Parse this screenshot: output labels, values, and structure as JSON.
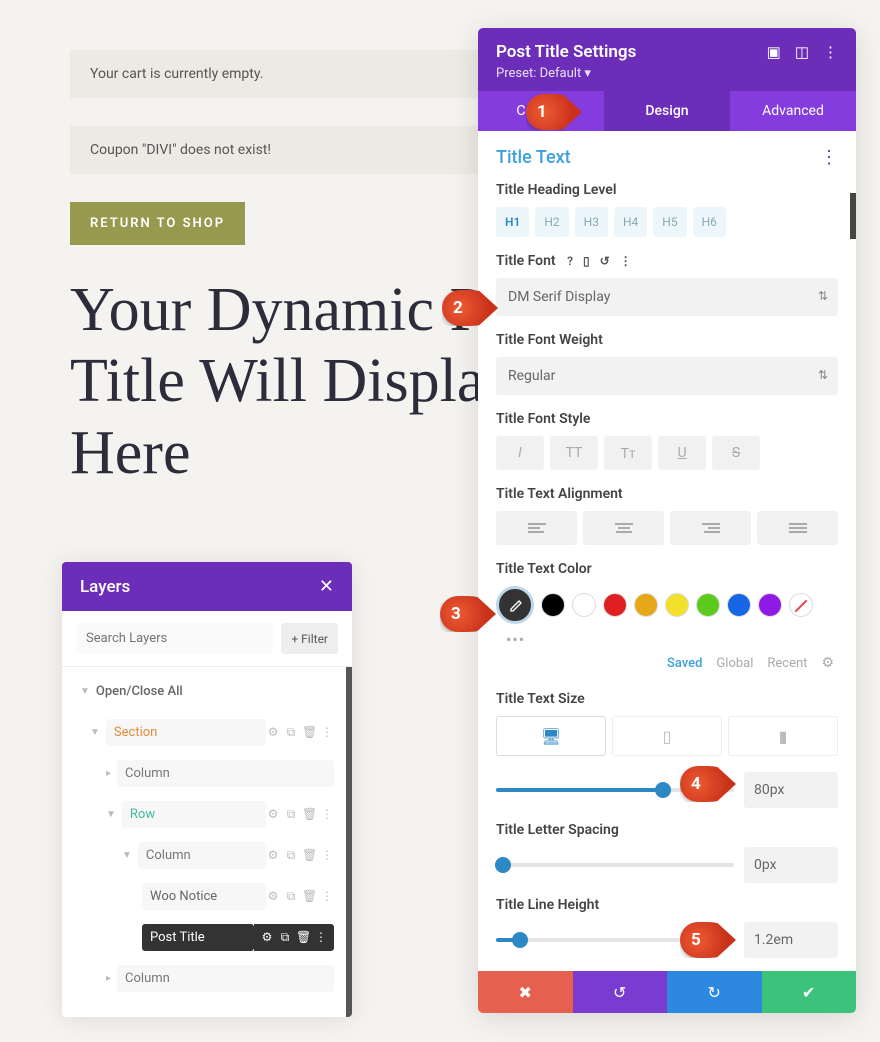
{
  "page": {
    "empty_cart": "Your cart is currently empty.",
    "coupon_error": "Coupon \"DIVI\" does not exist!",
    "return_btn": "RETURN TO SHOP",
    "post_title": "Your Dynamic Post Title Will Display Here"
  },
  "layers": {
    "title": "Layers",
    "search_placeholder": "Search Layers",
    "filter_btn": "+ Filter",
    "open_close": "Open/Close All",
    "items": {
      "section": "Section",
      "column1": "Column",
      "row": "Row",
      "column2": "Column",
      "woo": "Woo Notice",
      "posttitle": "Post Title",
      "column3": "Column"
    }
  },
  "settings": {
    "header": "Post Title Settings",
    "preset": "Preset: Default ▾",
    "tabs": {
      "content": "Content",
      "design": "Design",
      "advanced": "Advanced"
    },
    "section_title": "Title Text",
    "heading_level_label": "Title Heading Level",
    "heading_levels": [
      "H1",
      "H2",
      "H3",
      "H4",
      "H5",
      "H6"
    ],
    "font_label": "Title Font",
    "font_value": "DM Serif Display",
    "weight_label": "Title Font Weight",
    "weight_value": "Regular",
    "style_label": "Title Font Style",
    "align_label": "Title Text Alignment",
    "color_label": "Title Text Color",
    "colors": [
      "#000000",
      "#ffffff",
      "#e02020",
      "#e6a817",
      "#f2e02a",
      "#5bca1c",
      "#1766e6",
      "#8f1ae6"
    ],
    "color_tabs": {
      "saved": "Saved",
      "global": "Global",
      "recent": "Recent"
    },
    "size_label": "Title Text Size",
    "size_value": "80px",
    "spacing_label": "Title Letter Spacing",
    "spacing_value": "0px",
    "lineheight_label": "Title Line Height",
    "lineheight_value": "1.2em"
  },
  "callouts": {
    "c1": "1",
    "c2": "2",
    "c3": "3",
    "c4": "4",
    "c5": "5"
  }
}
